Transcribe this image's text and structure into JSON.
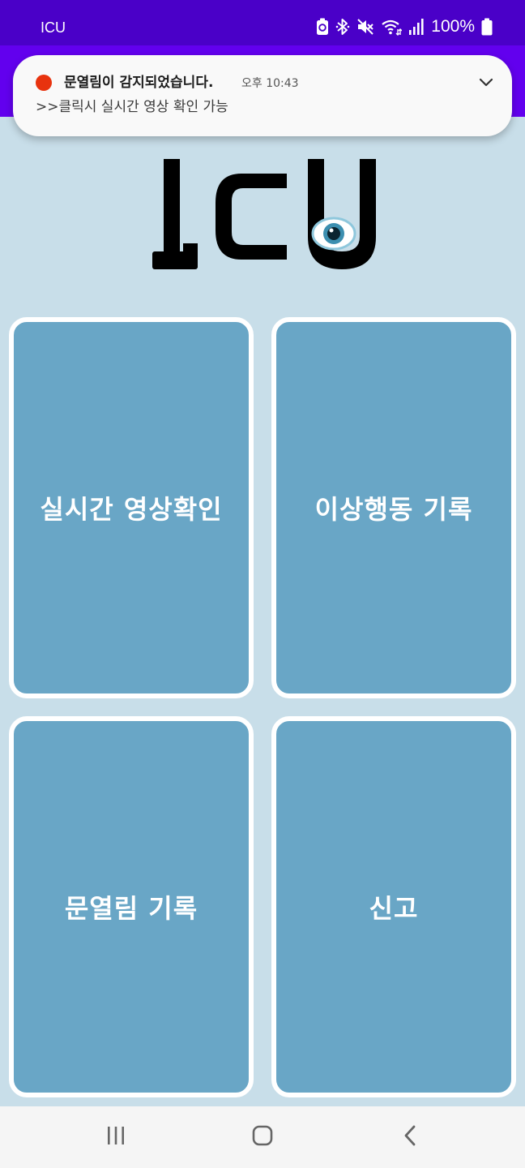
{
  "status_bar": {
    "app_title": "ICU",
    "battery_percent": "100%",
    "icons": [
      "battery-saver-icon",
      "bluetooth-icon",
      "mute-icon",
      "wifi-icon",
      "signal-icon",
      "battery-icon"
    ]
  },
  "notification": {
    "title": "문열림이 감지되었습니다.",
    "time": "오후 10:43",
    "body": ">>클릭시 실시간 영상 확인 가능",
    "status_color": "#e8330e"
  },
  "logo": {
    "text": "ICU"
  },
  "tiles": [
    {
      "label": "실시간 영상확인"
    },
    {
      "label": "이상행동 기록"
    },
    {
      "label": "문열림 기록"
    },
    {
      "label": "신고"
    }
  ],
  "nav_bar": {
    "items": [
      "recents-icon",
      "home-icon",
      "back-icon"
    ]
  },
  "colors": {
    "status_bar": "#4a00c8",
    "app_bar": "#6200ee",
    "background": "#c8dee9",
    "tile": "#69a6c6",
    "tile_border": "#ffffff"
  }
}
